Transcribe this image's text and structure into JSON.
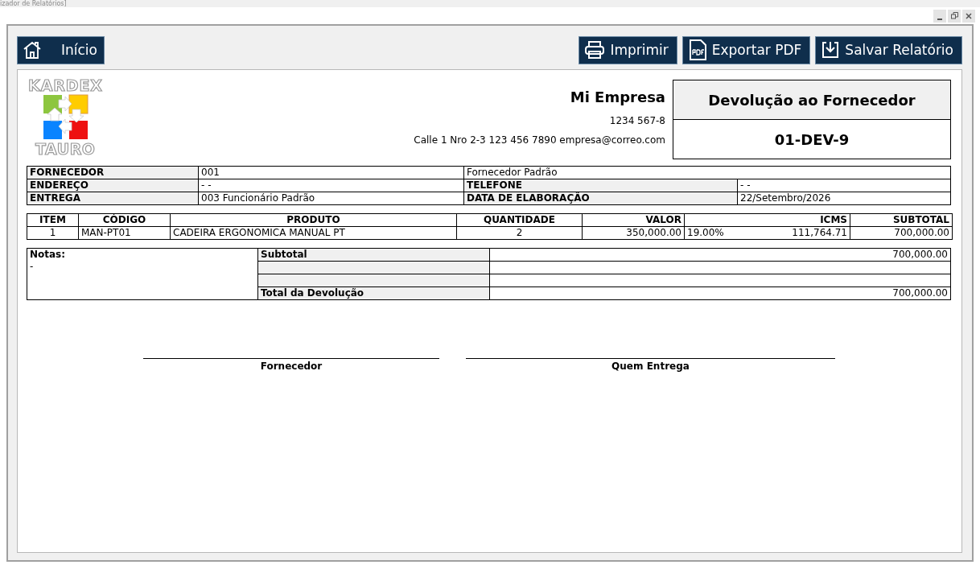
{
  "window": {
    "title": "izador de Relatórios]",
    "controls": [
      {
        "kind": "minimize"
      },
      {
        "kind": "restore"
      },
      {
        "kind": "close"
      }
    ]
  },
  "toolbar": {
    "home": {
      "label": "Início"
    },
    "actions": [
      {
        "kind": "print",
        "label": "Imprimir"
      },
      {
        "kind": "pdf",
        "label": "Exportar PDF"
      },
      {
        "kind": "save",
        "label": "Salvar Relatório"
      }
    ]
  },
  "report": {
    "logo": {
      "top": "KARDEX",
      "bottom": "TAURO"
    },
    "company": {
      "name": "Mi Empresa",
      "id": "1234 567-8",
      "contact": "Calle 1 Nro 2-3 123 456 7890 empresa@correo.com"
    },
    "document": {
      "title": "Devolução ao Fornecedor",
      "number": "01-DEV-9"
    },
    "info": [
      {
        "label": "FORNECEDOR",
        "value": "001",
        "extra": "Fornecedor Padrão"
      },
      {
        "label": "ENDEREÇO",
        "value": "- -",
        "label2": "TELEFONE",
        "value2": "- -"
      },
      {
        "label": "ENTREGA",
        "value": "003 Funcionário Padrão",
        "label2": "DATA DE ELABORAÇÃO",
        "value2": "22/Setembro/2026"
      }
    ],
    "items": {
      "columns": [
        "ITEM",
        "CÓDIGO",
        "PRODUTO",
        "QUANTIDADE",
        "VALOR",
        "ICMS",
        "SUBTOTAL"
      ],
      "rows": [
        {
          "item": "1",
          "code": "MAN-PT01",
          "product": "CADEIRA ERGONOMICA MANUAL PT",
          "quantity": "2",
          "value": "350,000.00",
          "icms_rate": "19.00%",
          "icms": "111,764.71",
          "subtotal": "700,000.00"
        }
      ]
    },
    "notes": {
      "label": "Notas:",
      "text": "-"
    },
    "totals": [
      {
        "kind": "amount",
        "label": "Subtotal",
        "value": "700,000.00"
      },
      {
        "kind": "blank"
      },
      {
        "kind": "blank"
      },
      {
        "kind": "amount",
        "label": "Total da Devolução",
        "value": "700,000.00"
      }
    ],
    "signatures": [
      "Fornecedor",
      "Quem Entrega"
    ]
  }
}
